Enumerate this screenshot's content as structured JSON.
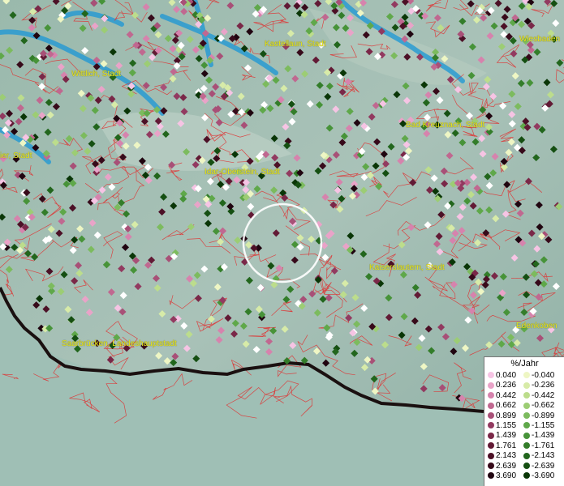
{
  "cities": [
    {
      "name": "Wittlich, Stadt"
    },
    {
      "name": "Kastellaun, Stadt"
    },
    {
      "name": "Wiesbaden"
    },
    {
      "name": "Bad Kreuznach, Stadt"
    },
    {
      "name": "ier, Stadt"
    },
    {
      "name": "Idar-Oberstein, Stadt"
    },
    {
      "name": "Kaiserslautern, Stadt"
    },
    {
      "name": "Saarbrücken, Landeshauptstadt"
    },
    {
      "name": "Edenkoben"
    }
  ],
  "legend": {
    "title": "%/Jahr",
    "positive": {
      "values": [
        "0.040",
        "0.236",
        "0.442",
        "0.662",
        "0.899",
        "1.155",
        "1.439",
        "1.761",
        "2.143",
        "2.639",
        "3.690"
      ],
      "colors": [
        "#f6c4e4",
        "#e9a3c8",
        "#d683ad",
        "#c06890",
        "#a85077",
        "#923a60",
        "#7a2848",
        "#621a35",
        "#4c1026",
        "#370a1a",
        "#200510"
      ]
    },
    "negative": {
      "values": [
        "-0.040",
        "-0.236",
        "-0.442",
        "-0.662",
        "-0.899",
        "-1.155",
        "-1.439",
        "-1.761",
        "-2.143",
        "-2.639",
        "-3.690"
      ],
      "colors": [
        "#eef6c4",
        "#d7eba8",
        "#bcdd8c",
        "#9ccd74",
        "#7cbb5e",
        "#5fa84a",
        "#479339",
        "#337d2a",
        "#22661d",
        "#154f12",
        "#0a3607"
      ]
    }
  },
  "colors": {
    "terrain": "#8fb3a6",
    "river": "#2a9bd2",
    "border_red": "#e03030",
    "state_border": "#1a1010",
    "label_yellow": "#e8e820"
  }
}
